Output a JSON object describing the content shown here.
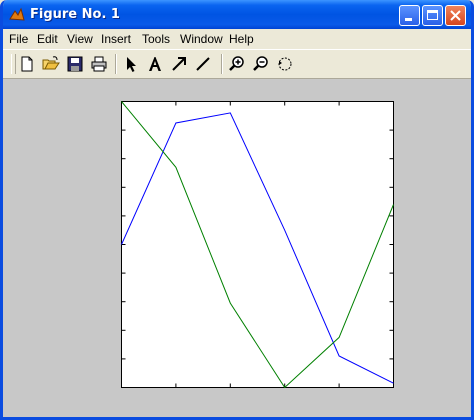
{
  "window": {
    "title": "Figure No. 1"
  },
  "menu": {
    "items": [
      "File",
      "Edit",
      "View",
      "Insert",
      "Tools",
      "Window",
      "Help"
    ]
  },
  "toolbar": {
    "icons": [
      "new-figure-icon",
      "open-file-icon",
      "save-icon",
      "print-icon",
      "edit-plot-arrow-icon",
      "insert-text-icon",
      "insert-arrow-icon",
      "insert-line-icon",
      "zoom-in-icon",
      "zoom-out-icon",
      "rotate-3d-icon"
    ]
  },
  "chart_data": {
    "type": "line",
    "xlim": [
      1,
      6
    ],
    "ylim": [
      -1,
      1
    ],
    "x": [
      1,
      2,
      3,
      4,
      5,
      6
    ],
    "series": [
      {
        "color": "#0000ff",
        "values": [
          0.0,
          0.85,
          0.92,
          0.1,
          -0.78,
          -0.97
        ]
      },
      {
        "color": "#008000",
        "values": [
          1.0,
          0.54,
          -0.41,
          -1.0,
          -0.65,
          0.28
        ]
      }
    ],
    "grid": false,
    "x_ticks": 6,
    "y_ticks": 11,
    "tick_labels_shown": false
  }
}
